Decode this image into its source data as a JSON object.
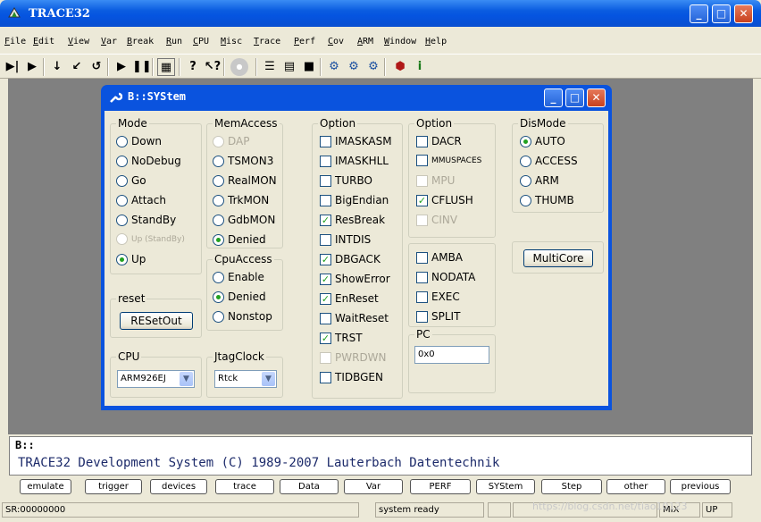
{
  "window": {
    "title": "TRACE32"
  },
  "menu": [
    "File",
    "Edit",
    "View",
    "Var",
    "Break",
    "Run",
    "CPU",
    "Misc",
    "Trace",
    "Perf",
    "Cov",
    "ARM",
    "Window",
    "Help"
  ],
  "dialog": {
    "title": "B::SYStem",
    "mode": {
      "legend": "Mode",
      "items": [
        {
          "label": "Down",
          "checked": false
        },
        {
          "label": "NoDebug",
          "checked": false
        },
        {
          "label": "Go",
          "checked": false
        },
        {
          "label": "Attach",
          "checked": false
        },
        {
          "label": "StandBy",
          "checked": false
        },
        {
          "label": "Up (StandBy)",
          "checked": false,
          "disabled": true
        },
        {
          "label": "Up",
          "checked": true
        }
      ]
    },
    "memaccess": {
      "legend": "MemAccess",
      "items": [
        {
          "label": "DAP",
          "checked": false,
          "disabled": true
        },
        {
          "label": "TSMON3",
          "checked": false
        },
        {
          "label": "RealMON",
          "checked": false
        },
        {
          "label": "TrkMON",
          "checked": false
        },
        {
          "label": "GdbMON",
          "checked": false
        },
        {
          "label": "Denied",
          "checked": true
        }
      ]
    },
    "cpuaccess": {
      "legend": "CpuAccess",
      "items": [
        {
          "label": "Enable",
          "checked": false
        },
        {
          "label": "Denied",
          "checked": true
        },
        {
          "label": "Nonstop",
          "checked": false
        }
      ]
    },
    "reset": {
      "legend": "reset",
      "button": "RESetOut"
    },
    "cpu": {
      "legend": "CPU",
      "value": "ARM926EJ"
    },
    "jtagclock": {
      "legend": "JtagClock",
      "value": "Rtck"
    },
    "option1": {
      "legend": "Option",
      "items": [
        {
          "label": "IMASKASM",
          "checked": false
        },
        {
          "label": "IMASKHLL",
          "checked": false
        },
        {
          "label": "TURBO",
          "checked": false
        },
        {
          "label": "BigEndian",
          "checked": false
        },
        {
          "label": "ResBreak",
          "checked": true
        },
        {
          "label": "INTDIS",
          "checked": false
        },
        {
          "label": "DBGACK",
          "checked": true
        },
        {
          "label": "ShowError",
          "checked": true
        },
        {
          "label": "EnReset",
          "checked": true
        },
        {
          "label": "WaitReset",
          "checked": false
        },
        {
          "label": "TRST",
          "checked": true
        },
        {
          "label": "PWRDWN",
          "checked": false,
          "disabled": true
        },
        {
          "label": "TIDBGEN",
          "checked": false
        }
      ]
    },
    "option2": {
      "legend": "Option",
      "items": [
        {
          "label": "DACR",
          "checked": false
        },
        {
          "label": "MMUSPACES",
          "checked": false
        },
        {
          "label": "MPU",
          "checked": false,
          "disabled": true
        },
        {
          "label": "CFLUSH",
          "checked": true
        },
        {
          "label": "CINV",
          "checked": false,
          "disabled": true
        }
      ]
    },
    "option3": {
      "items": [
        {
          "label": "AMBA",
          "checked": false
        },
        {
          "label": "NODATA",
          "checked": false
        },
        {
          "label": "EXEC",
          "checked": false
        },
        {
          "label": "SPLIT",
          "checked": false
        }
      ]
    },
    "pc": {
      "legend": "PC",
      "value": "0x0"
    },
    "dismode": {
      "legend": "DisMode",
      "items": [
        {
          "label": "AUTO",
          "checked": true
        },
        {
          "label": "ACCESS",
          "checked": false
        },
        {
          "label": "ARM",
          "checked": false
        },
        {
          "label": "THUMB",
          "checked": false
        }
      ]
    },
    "multicore": "MultiCore"
  },
  "command": {
    "prompt": "B::",
    "message": "TRACE32 Development System (C) 1989-2007 Lauterbach Datentechnik"
  },
  "softkeys": [
    "emulate",
    "trigger",
    "devices",
    "trace",
    "Data",
    "Var",
    "PERF",
    "SYStem",
    "Step",
    "other",
    "previous"
  ],
  "status": {
    "address": "SR:00000000",
    "state": "system ready",
    "mix": "MIX",
    "up": "UP",
    "watermark": "https://blog.csdn.net/tiao10123"
  }
}
